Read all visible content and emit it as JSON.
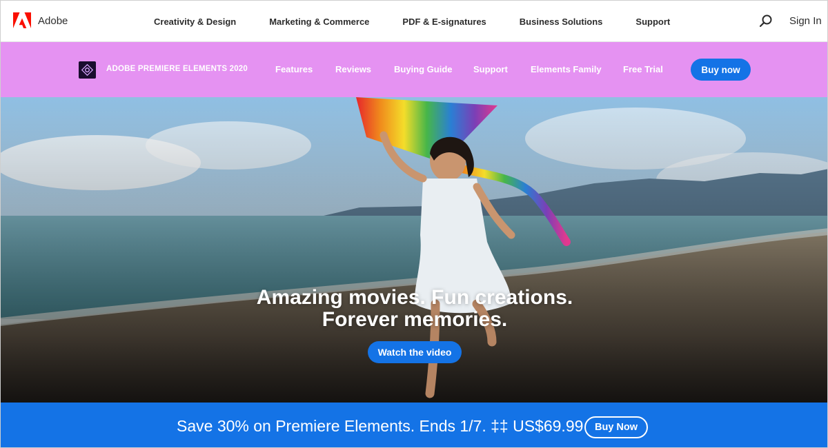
{
  "global_nav": {
    "brand": "Adobe",
    "links": [
      "Creativity & Design",
      "Marketing & Commerce",
      "PDF & E-signatures",
      "Business Solutions",
      "Support"
    ],
    "sign_in": "Sign In"
  },
  "product_bar": {
    "product_name": "ADOBE PREMIERE ELEMENTS 2020",
    "links": [
      "Features",
      "Reviews",
      "Buying Guide",
      "Support",
      "Elements Family",
      "Free Trial"
    ],
    "buy_now": "Buy now"
  },
  "hero": {
    "headline_line1": "Amazing movies. Fun creations.",
    "headline_line2": "Forever memories.",
    "cta": "Watch the video"
  },
  "promo": {
    "text": "Save 30% on Premiere Elements. Ends 1/7. ‡‡ US$69.99",
    "cta": "Buy Now"
  },
  "colors": {
    "adobe_red": "#fa0f00",
    "product_bar": "#e592f2",
    "accent_blue": "#1473e6"
  },
  "icons": [
    "adobe-logo-icon",
    "search-icon",
    "premiere-elements-icon"
  ]
}
